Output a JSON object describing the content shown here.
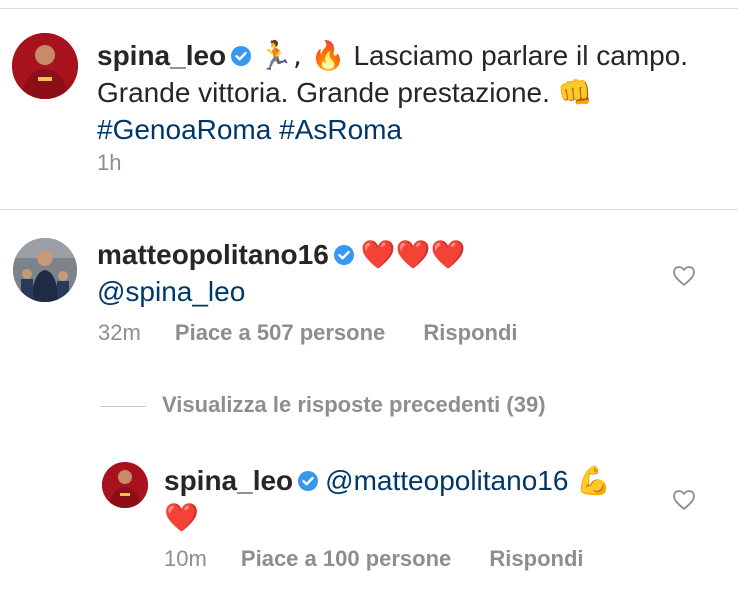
{
  "caption": {
    "username": "spina_leo",
    "emoji_run": "🏃, 🔥",
    "text": "Lasciamo parlare il campo. Grande vittoria. Grande prestazione.",
    "emoji_end": "👊",
    "hashtags": [
      "#GenoaRoma",
      "#AsRoma"
    ],
    "time": "1h"
  },
  "comments": [
    {
      "username": "matteopolitano16",
      "emojis": "❤️❤️❤️",
      "mention": "@spina_leo",
      "time": "32m",
      "likes_label": "Piace a 507 persone",
      "reply_label": "Rispondi",
      "like_icon": "heart-outline-icon"
    }
  ],
  "view_replies_label": "Visualizza le risposte precedenti (39)",
  "reply": {
    "username": "spina_leo",
    "mention": "@matteopolitano16",
    "emoji_mid": "💪",
    "emoji_end": "❤️",
    "time": "10m",
    "likes_label": "Piace a 100 persone",
    "reply_label": "Rispondi",
    "like_icon": "heart-outline-icon"
  },
  "colors": {
    "verified": "#3897f0",
    "hashtag": "#00376b",
    "meta": "#8e8e8e",
    "heart": "#e0171e",
    "roma_red": "#b3141f"
  }
}
